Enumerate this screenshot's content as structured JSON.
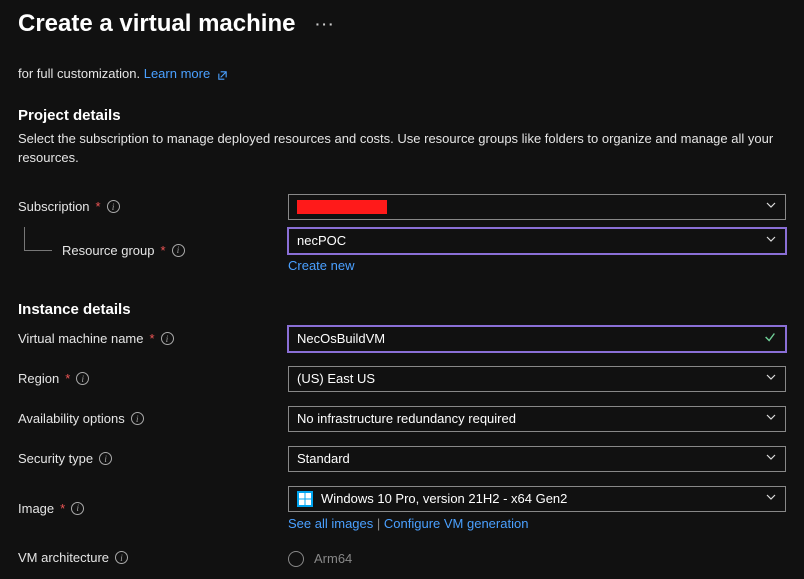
{
  "header": {
    "title": "Create a virtual machine",
    "more": "···"
  },
  "intro": {
    "text": "for full customization. ",
    "learn_more": "Learn more"
  },
  "project": {
    "heading": "Project details",
    "desc": "Select the subscription to manage deployed resources and costs. Use resource groups like folders to organize and manage all your resources.",
    "subscription_label": "Subscription",
    "subscription_value": "[redacted]",
    "rg_label": "Resource group",
    "rg_value": "necPOC",
    "create_new": "Create new"
  },
  "instance": {
    "heading": "Instance details",
    "vm_name_label": "Virtual machine name",
    "vm_name_value": "NecOsBuildVM",
    "region_label": "Region",
    "region_value": "(US) East US",
    "avail_label": "Availability options",
    "avail_value": "No infrastructure redundancy required",
    "sec_label": "Security type",
    "sec_value": "Standard",
    "image_label": "Image",
    "image_value": "Windows 10 Pro, version 21H2 - x64 Gen2",
    "see_all": "See all images",
    "configure_gen": "Configure VM generation",
    "arch_label": "VM architecture",
    "arch_option_arm": "Arm64"
  }
}
